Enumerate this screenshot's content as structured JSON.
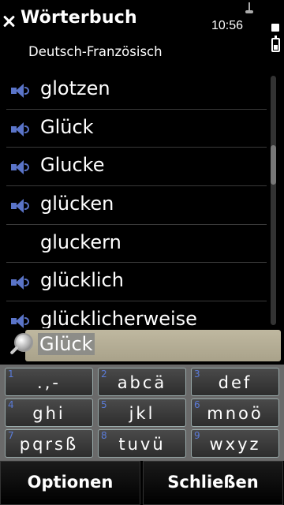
{
  "header": {
    "title": "Wörterbuch",
    "time": "10:56",
    "subtitle": "Deutsch-Französisch"
  },
  "words": [
    {
      "text": "glotzen",
      "has_audio": true
    },
    {
      "text": "Glück",
      "has_audio": true
    },
    {
      "text": "Glucke",
      "has_audio": true
    },
    {
      "text": "glücken",
      "has_audio": true
    },
    {
      "text": "gluckern",
      "has_audio": false
    },
    {
      "text": "glücklich",
      "has_audio": true
    },
    {
      "text": "glücklicherweise",
      "has_audio": true
    }
  ],
  "search": {
    "value": "Glück"
  },
  "keypad": [
    {
      "digit": "1",
      "letters": ".,-"
    },
    {
      "digit": "2",
      "letters": "abcä"
    },
    {
      "digit": "3",
      "letters": "def"
    },
    {
      "digit": "4",
      "letters": "ghi"
    },
    {
      "digit": "5",
      "letters": "jkl"
    },
    {
      "digit": "6",
      "letters": "mnoö"
    },
    {
      "digit": "7",
      "letters": "pqrsß"
    },
    {
      "digit": "8",
      "letters": "tuvü"
    },
    {
      "digit": "9",
      "letters": "wxyz"
    }
  ],
  "softkeys": {
    "left": "Optionen",
    "right": "Schließen"
  },
  "colors": {
    "accent": "#5a74c8",
    "search_field": "#b8b199"
  }
}
